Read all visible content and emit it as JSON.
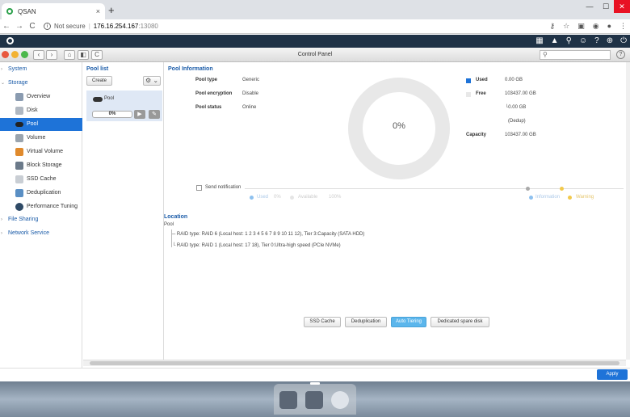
{
  "browser": {
    "tab_title": "QSAN",
    "tab_close": "×",
    "new_tab": "+",
    "not_secure": "Not secure",
    "url_host": "176.16.254.167",
    "url_port": ":13080"
  },
  "window": {
    "title": "Control Panel",
    "search_placeholder": "",
    "help": "?"
  },
  "sidebar": {
    "groups": [
      {
        "label": "System"
      },
      {
        "label": "Storage"
      },
      {
        "label": "File Sharing"
      },
      {
        "label": "Network Service"
      }
    ],
    "items": [
      {
        "label": "Overview",
        "icon": "overview-icon"
      },
      {
        "label": "Disk",
        "icon": "disk-icon"
      },
      {
        "label": "Pool",
        "icon": "pool-icon"
      },
      {
        "label": "Volume",
        "icon": "volume-icon"
      },
      {
        "label": "Virtual Volume",
        "icon": "virtual-volume-icon"
      },
      {
        "label": "Block Storage",
        "icon": "block-storage-icon"
      },
      {
        "label": "SSD Cache",
        "icon": "ssd-cache-icon"
      },
      {
        "label": "Deduplication",
        "icon": "deduplication-icon"
      },
      {
        "label": "Performance Tuning",
        "icon": "performance-tuning-icon"
      }
    ],
    "active": "Pool"
  },
  "pool_list": {
    "title": "Pool list",
    "create_label": "Create",
    "pool_name": "Pool",
    "progress_text": "0%",
    "progress": 0
  },
  "pool_info": {
    "title": "Pool Information",
    "rows": [
      {
        "label": "Pool type",
        "value": "Generic"
      },
      {
        "label": "Pool encryption",
        "value": "Disable"
      },
      {
        "label": "Pool status",
        "value": "Online"
      }
    ],
    "usage_percent": "0%",
    "used_label": "Used",
    "used_value": "0.00 GB",
    "free_label": "Free",
    "free_value": "103437.00 GB",
    "dedup_value": "└0.00 GB",
    "dedup_label": "(Dedup)",
    "capacity_label": "Capacity",
    "capacity_value": "103437.00 GB",
    "used_color": "#1e73d8",
    "free_color": "#e8e8e8"
  },
  "notification": {
    "label": "Send notification",
    "legend_used": "Used",
    "legend_used_value": "0%",
    "legend_available": "Available",
    "legend_available_value": "100%",
    "legend_information": "Information",
    "legend_warning": "Warning"
  },
  "location": {
    "title": "Location",
    "root": "Pool",
    "raids": [
      "RAID type: RAID 6 (Local host: 1 2 3 4 5 6 7 8 9 10 11 12), Tier 3:Capacity (SATA HDD)",
      "RAID type: RAID 1 (Local host: 17 18), Tier 0:Ultra-high speed (PCIe NVMe)"
    ]
  },
  "tabs": [
    {
      "label": "SSD Cache"
    },
    {
      "label": "Deduplication"
    },
    {
      "label": "Auto Tiering"
    },
    {
      "label": "Dedicated spare disk"
    }
  ],
  "footer": {
    "apply_label": "Apply"
  }
}
